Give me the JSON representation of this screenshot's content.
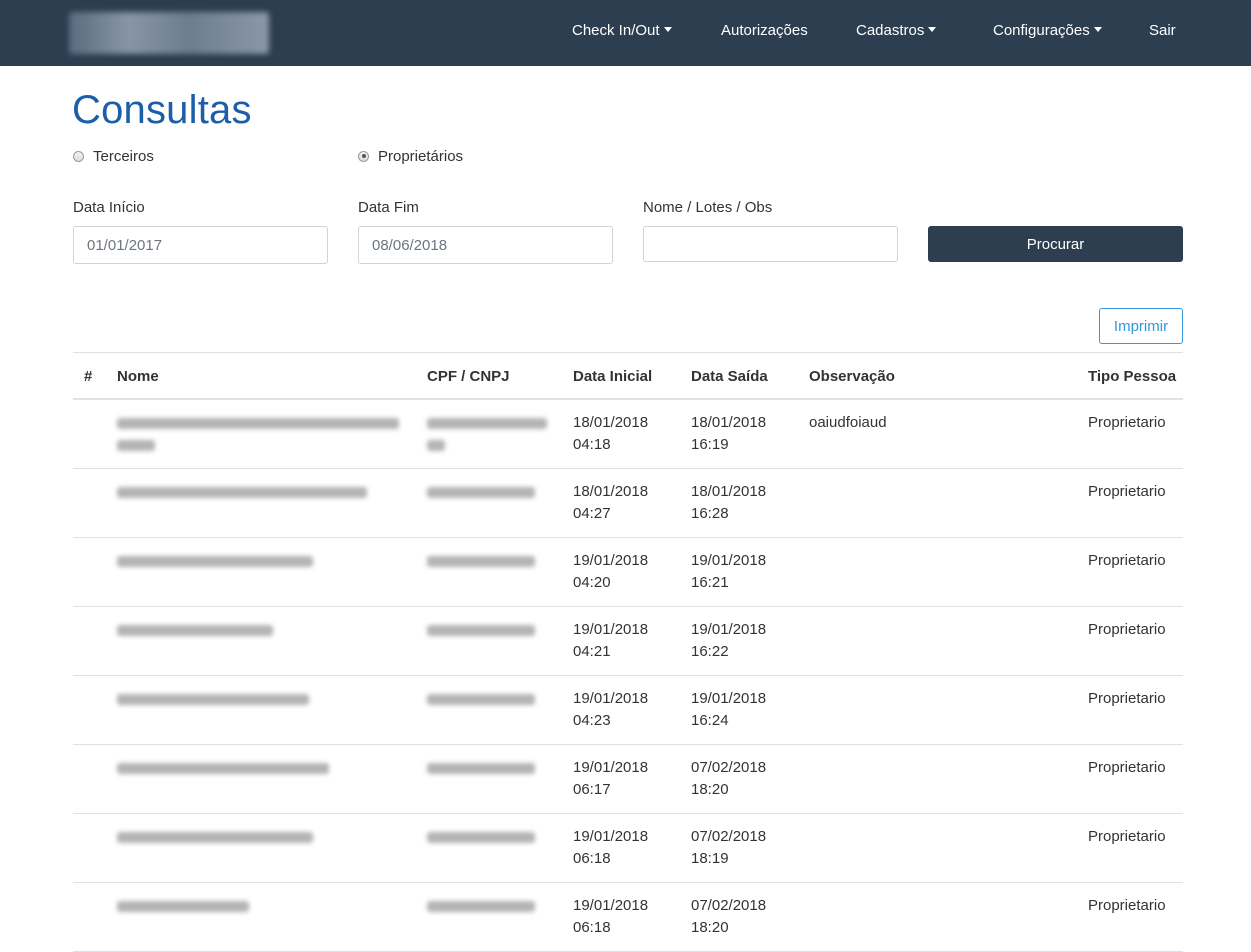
{
  "nav": {
    "items": [
      {
        "label": "Check In/Out",
        "dropdown": true
      },
      {
        "label": "Autorizações",
        "dropdown": false
      },
      {
        "label": "Cadastros",
        "dropdown": true
      },
      {
        "label": "Configurações",
        "dropdown": true
      },
      {
        "label": "Sair",
        "dropdown": false
      }
    ]
  },
  "page": {
    "title": "Consultas"
  },
  "filters": {
    "radio_terceiros": "Terceiros",
    "radio_proprietarios": "Proprietários",
    "selected": "Proprietários",
    "data_inicio_label": "Data Início",
    "data_inicio_value": "01/01/2017",
    "data_fim_label": "Data Fim",
    "data_fim_value": "08/06/2018",
    "nome_label": "Nome / Lotes / Obs",
    "nome_value": "",
    "search_button": "Procurar"
  },
  "print_button": "Imprimir",
  "table": {
    "headers": {
      "hash": "#",
      "nome": "Nome",
      "cpf": "CPF / CNPJ",
      "data_inicial": "Data Inicial",
      "data_saida": "Data Saída",
      "observacao": "Observação",
      "tipo_pessoa": "Tipo Pessoa"
    },
    "rows": [
      {
        "data_inicial_date": "18/01/2018",
        "data_inicial_time": "04:18",
        "data_saida_date": "18/01/2018",
        "data_saida_time": "16:19",
        "observacao": "oaiudfoiaud",
        "tipo": "Proprietario"
      },
      {
        "data_inicial_date": "18/01/2018",
        "data_inicial_time": "04:27",
        "data_saida_date": "18/01/2018",
        "data_saida_time": "16:28",
        "observacao": "",
        "tipo": "Proprietario"
      },
      {
        "data_inicial_date": "19/01/2018",
        "data_inicial_time": "04:20",
        "data_saida_date": "19/01/2018",
        "data_saida_time": "16:21",
        "observacao": "",
        "tipo": "Proprietario"
      },
      {
        "data_inicial_date": "19/01/2018",
        "data_inicial_time": "04:21",
        "data_saida_date": "19/01/2018",
        "data_saida_time": "16:22",
        "observacao": "",
        "tipo": "Proprietario"
      },
      {
        "data_inicial_date": "19/01/2018",
        "data_inicial_time": "04:23",
        "data_saida_date": "19/01/2018",
        "data_saida_time": "16:24",
        "observacao": "",
        "tipo": "Proprietario"
      },
      {
        "data_inicial_date": "19/01/2018",
        "data_inicial_time": "06:17",
        "data_saida_date": "07/02/2018",
        "data_saida_time": "18:20",
        "observacao": "",
        "tipo": "Proprietario"
      },
      {
        "data_inicial_date": "19/01/2018",
        "data_inicial_time": "06:18",
        "data_saida_date": "07/02/2018",
        "data_saida_time": "18:19",
        "observacao": "",
        "tipo": "Proprietario"
      },
      {
        "data_inicial_date": "19/01/2018",
        "data_inicial_time": "06:18",
        "data_saida_date": "07/02/2018",
        "data_saida_time": "18:20",
        "observacao": "",
        "tipo": "Proprietario"
      }
    ]
  }
}
